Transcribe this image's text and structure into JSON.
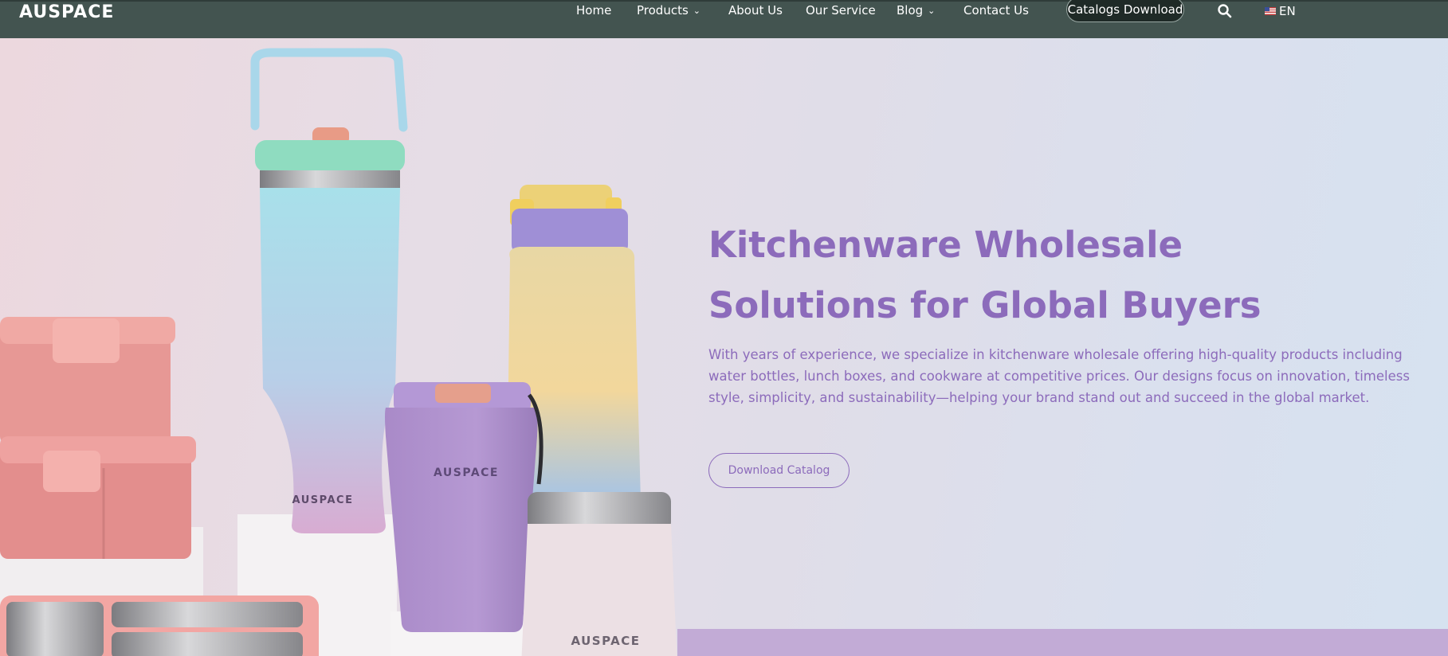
{
  "header": {
    "logo": "AUSPACE",
    "nav": [
      {
        "label": "Home"
      },
      {
        "label": "Products"
      },
      {
        "label": "About Us"
      },
      {
        "label": "Our Service"
      },
      {
        "label": "Blog"
      },
      {
        "label": "Contact Us"
      }
    ],
    "catalogs_button": "Catalogs Download",
    "search_icon": "search-icon",
    "language": "EN",
    "colors": {
      "bar": "#435450",
      "button": "#1f2a27"
    }
  },
  "hero": {
    "title_line1": "Kitchenware Wholesale",
    "title_line2": "Solutions for Global Buyers",
    "description": "With years of experience, we specialize in kitchenware wholesale offering high-quality products including water bottles, lunch boxes, and cookware at competitive prices. Our designs focus on innovation, timeless style, simplicity, and sustainability—helping your brand stand out and succeed in the global market.",
    "cta_button": "Download Catalog",
    "product_brand_marks": [
      "AUSPACE",
      "AUSPACE",
      "AUSPACE"
    ],
    "colors": {
      "accent": "#8c6bbb"
    }
  }
}
